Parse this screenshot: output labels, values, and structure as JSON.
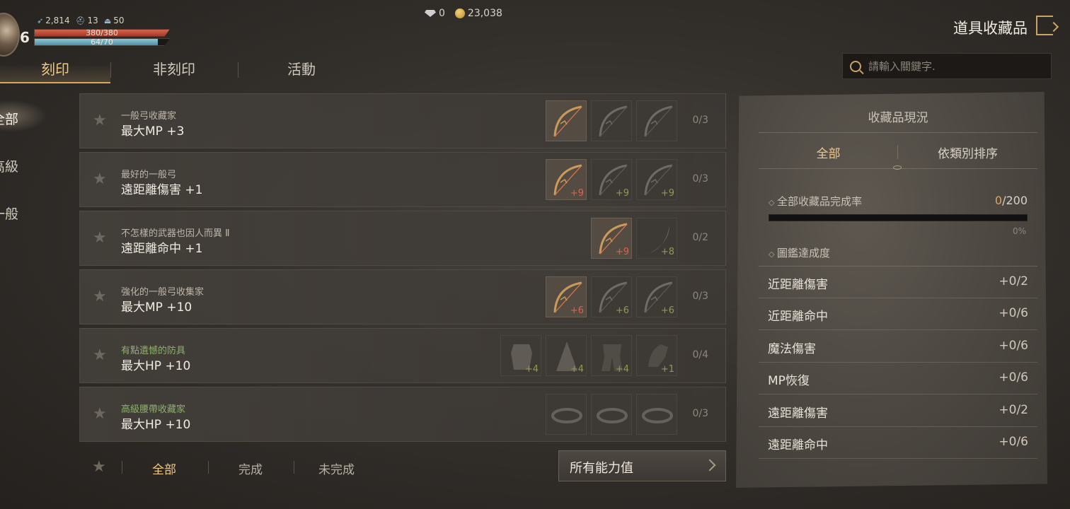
{
  "player": {
    "level": "6",
    "stat_a": "2,814",
    "stat_b": "13",
    "stat_c": "50",
    "hp_text": "380/380",
    "hp_ratio": 1.0,
    "mp_text": "64/70",
    "mp_ratio": 0.914
  },
  "currency": {
    "diamonds": "0",
    "adena": "23,038"
  },
  "screen_title": "道具收藏品",
  "tabs": [
    "刻印",
    "非刻印",
    "活動"
  ],
  "search": {
    "placeholder": "請輸入關鍵字."
  },
  "sidebar": [
    {
      "label": "全部",
      "active": true
    },
    {
      "label": "高級",
      "active": false
    },
    {
      "label": "一般",
      "active": false
    }
  ],
  "collections": [
    {
      "name": "一般弓收藏家",
      "effect": "最大MP +3",
      "count": "0/3",
      "grade": "common",
      "slots": [
        {
          "icon": "bow-icon",
          "owned": true,
          "enh": ""
        },
        {
          "icon": "bow-icon",
          "owned": false,
          "enh": ""
        },
        {
          "icon": "bow-icon",
          "owned": false,
          "enh": ""
        }
      ]
    },
    {
      "name": "最好的一般弓",
      "effect": "遠距離傷害 +1",
      "count": "0/3",
      "grade": "common",
      "slots": [
        {
          "icon": "bow-icon",
          "owned": true,
          "enh": "+9",
          "enh_color": "red"
        },
        {
          "icon": "bow-icon",
          "owned": false,
          "enh": "+9"
        },
        {
          "icon": "bow-icon",
          "owned": false,
          "enh": "+9"
        }
      ]
    },
    {
      "name": "不怎樣的武器也因人而異 Ⅱ",
      "effect": "遠距離命中 +1",
      "count": "0/2",
      "grade": "common",
      "slots": [
        {
          "icon": "bow-icon",
          "owned": true,
          "enh": "+9",
          "enh_color": "red"
        },
        {
          "icon": "scimitar-icon",
          "owned": false,
          "enh": "+8"
        }
      ]
    },
    {
      "name": "強化的一般弓收集家",
      "effect": "最大MP +10",
      "count": "0/3",
      "grade": "common",
      "slots": [
        {
          "icon": "bow-icon",
          "owned": true,
          "enh": "+6",
          "enh_color": "red"
        },
        {
          "icon": "bow-icon",
          "owned": false,
          "enh": "+6"
        },
        {
          "icon": "bow-icon",
          "owned": false,
          "enh": "+6"
        }
      ]
    },
    {
      "name": "有點遺憾的防具",
      "effect": "最大HP +10",
      "count": "0/4",
      "grade": "uncommon",
      "slots": [
        {
          "icon": "armor-icon",
          "owned": false,
          "enh": "+4"
        },
        {
          "icon": "cloak-icon",
          "owned": false,
          "enh": "+4"
        },
        {
          "icon": "leg-armor-icon",
          "owned": false,
          "enh": "+4"
        },
        {
          "icon": "gauntlet-icon",
          "owned": false,
          "enh": "+1"
        }
      ]
    },
    {
      "name": "高級腰帶收藏家",
      "effect": "最大HP +10",
      "count": "0/3",
      "grade": "uncommon",
      "slots": [
        {
          "icon": "belt-icon",
          "owned": false,
          "enh": ""
        },
        {
          "icon": "belt-icon",
          "owned": false,
          "enh": ""
        },
        {
          "icon": "belt-icon",
          "owned": false,
          "enh": ""
        }
      ]
    }
  ],
  "filters": [
    "全部",
    "完成",
    "未完成"
  ],
  "all_stats_button": "所有能力值",
  "panel": {
    "title": "收藏品現況",
    "tabs": [
      "全部",
      "依類別排序"
    ],
    "completion_label": "全部收藏品完成率",
    "completion_done": "0",
    "completion_total": "/200",
    "completion_percent": "0%",
    "completion_ratio": 0,
    "codex_label": "圖鑑達成度",
    "stats": [
      {
        "label": "近距離傷害",
        "value": "+0/2"
      },
      {
        "label": "近距離命中",
        "value": "+0/6"
      },
      {
        "label": "魔法傷害",
        "value": "+0/6"
      },
      {
        "label": "MP恢復",
        "value": "+0/6"
      },
      {
        "label": "遠距離傷害",
        "value": "+0/2"
      },
      {
        "label": "遠距離命中",
        "value": "+0/6"
      }
    ]
  }
}
